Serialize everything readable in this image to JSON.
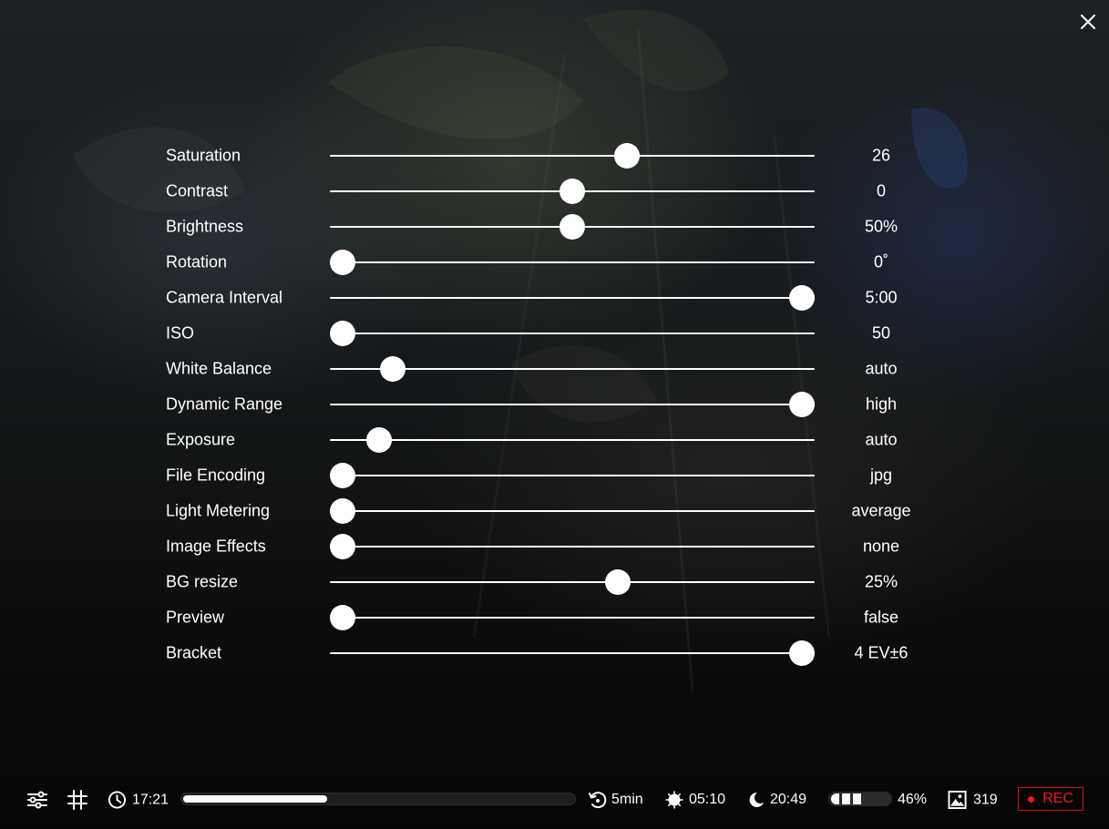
{
  "window": {
    "close_icon": "close-icon"
  },
  "settings": [
    {
      "label": "Saturation",
      "value": "26",
      "position": 0.62
    },
    {
      "label": "Contrast",
      "value": "0",
      "position": 0.5
    },
    {
      "label": "Brightness",
      "value": "50%",
      "position": 0.5
    },
    {
      "label": "Rotation",
      "value": "0˚",
      "position": 0.0
    },
    {
      "label": "Camera Interval",
      "value": "5:00",
      "position": 1.0
    },
    {
      "label": "ISO",
      "value": "50",
      "position": 0.0
    },
    {
      "label": "White Balance",
      "value": "auto",
      "position": 0.11
    },
    {
      "label": "Dynamic Range",
      "value": "high",
      "position": 1.0
    },
    {
      "label": "Exposure",
      "value": "auto",
      "position": 0.08
    },
    {
      "label": "File Encoding",
      "value": "jpg",
      "position": 0.0
    },
    {
      "label": "Light Metering",
      "value": "average",
      "position": 0.0
    },
    {
      "label": "Image Effects",
      "value": "none",
      "position": 0.0
    },
    {
      "label": "BG resize",
      "value": "25%",
      "position": 0.6
    },
    {
      "label": "Preview",
      "value": "false",
      "position": 0.0
    },
    {
      "label": "Bracket",
      "value": "4 EV±6",
      "position": 1.0
    }
  ],
  "status_bar": {
    "settings_icon": "sliders-icon",
    "grid_icon": "grid-icon",
    "clock_icon": "clock-icon",
    "time": "17:21",
    "progress_fraction": 0.37,
    "interval_icon": "timer-reset-icon",
    "interval": "5min",
    "sunrise_icon": "sun-icon",
    "sunrise": "05:10",
    "sunset_icon": "moon-icon",
    "sunset": "20:49",
    "battery_icon": "battery-icon",
    "battery": "46%",
    "battery_fraction": 0.46,
    "images_icon": "image-icon",
    "images": "319",
    "rec_label": "REC",
    "rec_color": "#f01818"
  }
}
